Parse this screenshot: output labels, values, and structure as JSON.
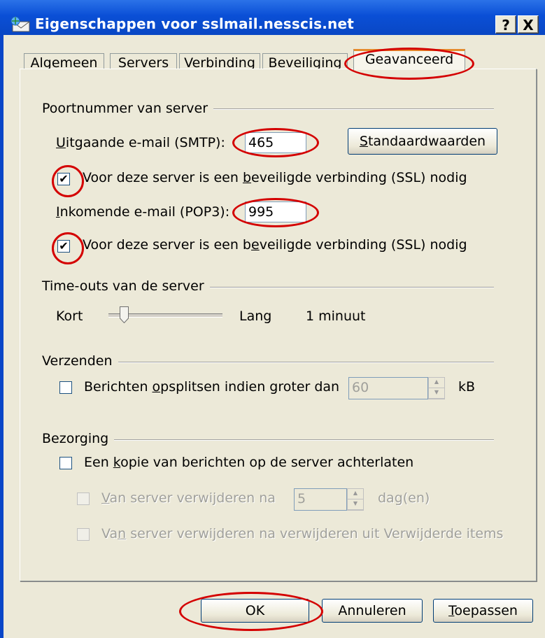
{
  "window": {
    "title": "Eigenschappen voor sslmail.nesscis.net",
    "help_label": "?",
    "close_label": "X"
  },
  "tabs": [
    {
      "label": "Algemeen"
    },
    {
      "label": "Servers"
    },
    {
      "label": "Verbinding"
    },
    {
      "label": "Beveiliging"
    },
    {
      "label": "Geavanceerd",
      "selected": true
    }
  ],
  "ports": {
    "group_title": "Poortnummer van server",
    "smtp_label_u": "U",
    "smtp_label_rest": "itgaande e-mail (SMTP):",
    "smtp_value": "465",
    "defaults_button_u": "S",
    "defaults_button_rest": "tandaardwaarden",
    "smtp_ssl_pre": "Voor deze server is een ",
    "smtp_ssl_u": "b",
    "smtp_ssl_post": "eveiligde verbinding (SSL) nodig",
    "smtp_ssl_checked": true,
    "pop3_label_u": "I",
    "pop3_label_rest": "nkomende e-mail (POP3):",
    "pop3_value": "995",
    "pop3_ssl_pre": "Voor deze server is een b",
    "pop3_ssl_u": "e",
    "pop3_ssl_post": "veiligde verbinding (SSL) nodig",
    "pop3_ssl_checked": true
  },
  "timeouts": {
    "group_title": "Time-outs van de server",
    "short_label": "Kort",
    "long_label": "Lang",
    "value_text": "1 minuut",
    "slider_level": 0.15
  },
  "sending": {
    "group_title": "Verzenden",
    "split_pre": "Berichten ",
    "split_u": "o",
    "split_post": "psplitsen indien groter dan",
    "split_value": "60",
    "unit": "kB",
    "split_checked": false
  },
  "delivery": {
    "group_title": "Bezorging",
    "copy_pre": "Een ",
    "copy_u": "k",
    "copy_post": "opie van berichten op de server achterlaten",
    "copy_checked": false,
    "remove_after_u": "V",
    "remove_after_rest": "an server verwijderen na",
    "remove_after_value": "5",
    "days_label": "dag(en)",
    "remove_deleted_pre": "Va",
    "remove_deleted_u": "n",
    "remove_deleted_post": " server verwijderen na verwijderen uit Verwijderde items"
  },
  "buttons": {
    "ok": "OK",
    "cancel": "Annuleren",
    "apply_u": "T",
    "apply_rest": "oepassen"
  },
  "colors": {
    "annotation": "#d40000",
    "titlebar": "#0a4fd6",
    "dialog_bg": "#ece9d8"
  }
}
